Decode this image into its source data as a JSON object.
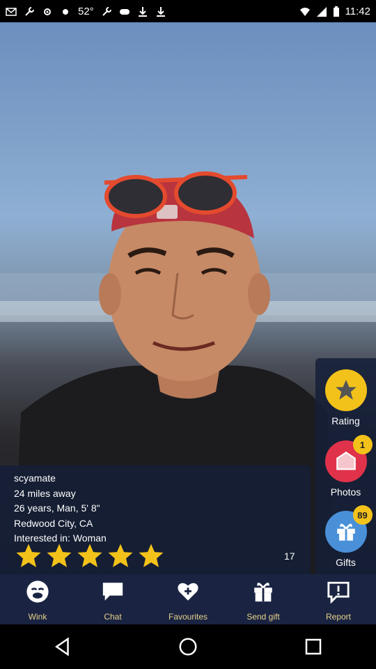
{
  "status_bar": {
    "temperature": "52°",
    "time": "11:42"
  },
  "profile": {
    "username": "scyamate",
    "distance": "24 miles away",
    "details": "26 years, Man, 5' 8\"",
    "location": "Redwood City, CA",
    "interest": "Interested in: Woman",
    "stars": 5,
    "rating_count": "17"
  },
  "side_actions": {
    "rating": {
      "label": "Rating"
    },
    "photos": {
      "label": "Photos",
      "badge": "1"
    },
    "gifts": {
      "label": "Gifts",
      "badge": "89"
    }
  },
  "tabs": {
    "wink": "Wink",
    "chat": "Chat",
    "favourites": "Favourites",
    "send_gift": "Send gift",
    "report": "Report"
  },
  "colors": {
    "accent": "#f3c21a",
    "tab_label": "#e8d18a",
    "tab_bar": "#1a2442",
    "photos_circle": "#e0324a"
  }
}
